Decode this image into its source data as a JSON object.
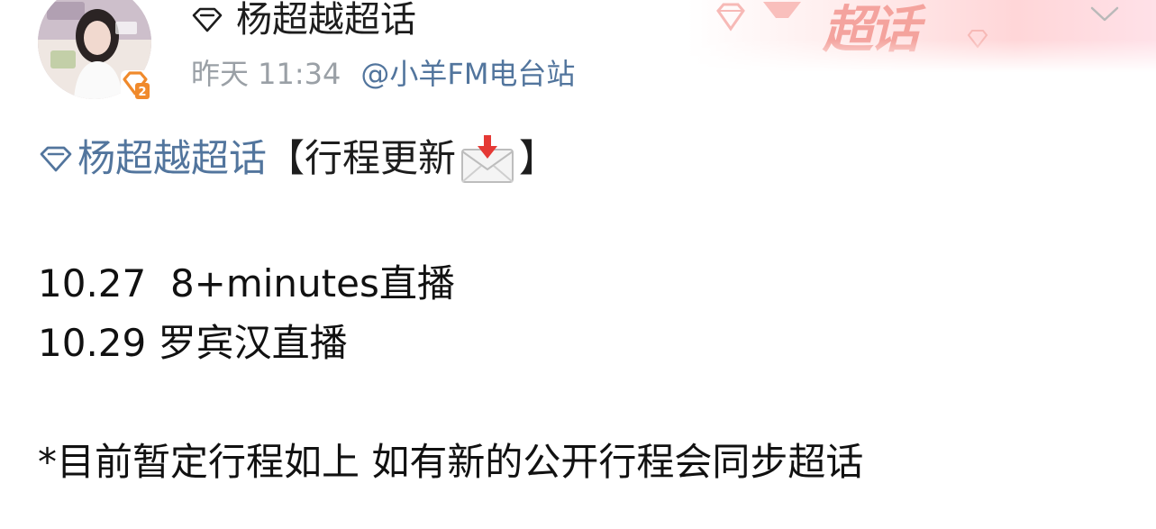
{
  "header": {
    "topic_name": "杨超越超话",
    "timestamp": "昨天 11:34",
    "source": "@小羊FM电台站"
  },
  "banner": {
    "wordmark": "超话",
    "colors": {
      "wordmark": "#f4a09a",
      "gem": "#f7b9b6"
    }
  },
  "post": {
    "topic_link": "杨超越超话",
    "bracket_open": "【",
    "bracket_title": "行程更新",
    "bracket_close": "】",
    "emoji": "envelope-with-arrow-icon",
    "schedule": [
      "10.27  8+minutes直播",
      "10.29 罗宾汉直播"
    ],
    "footnote": "*目前暂定行程如上 如有新的公开行程会同步超话"
  },
  "colors": {
    "link": "#52759d",
    "meta": "#9aa0a6",
    "text": "#111111",
    "badge": "#f08a2c"
  }
}
